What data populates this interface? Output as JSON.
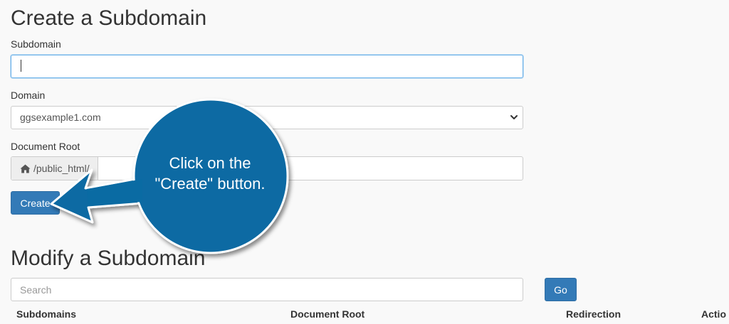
{
  "create_section": {
    "title": "Create a Subdomain",
    "subdomain_label": "Subdomain",
    "subdomain_value": "",
    "domain_label": "Domain",
    "domain_selected": "ggsexample1.com",
    "docroot_label": "Document Root",
    "docroot_prefix": "/public_html/",
    "docroot_value": "",
    "create_button": "Create"
  },
  "modify_section": {
    "title": "Modify a Subdomain",
    "search_placeholder": "Search",
    "go_button": "Go",
    "columns": [
      "Subdomains",
      "Document Root",
      "Redirection",
      "Actio"
    ]
  },
  "annotation": {
    "line1": "Click on the",
    "line2": "\"Create\" button.",
    "color": "#0a6ba3"
  },
  "colors": {
    "primary_button": "#337ab7",
    "focus_border": "#66afe9"
  },
  "icons": {
    "home": "home-icon",
    "select_arrow": "chevron-down-icon"
  }
}
